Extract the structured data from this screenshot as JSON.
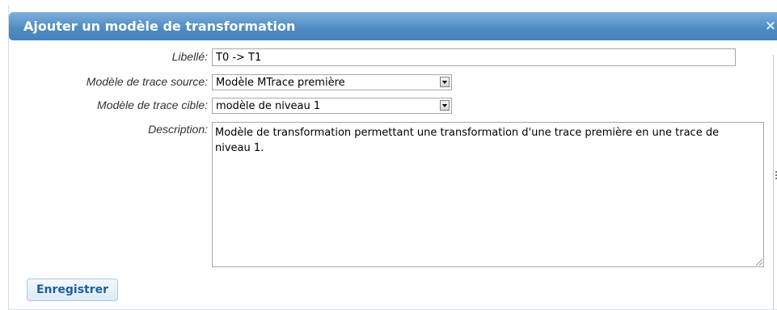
{
  "dialog": {
    "title": "Ajouter un modèle de transformation",
    "close_symbol": "×"
  },
  "form": {
    "libelle": {
      "label": "Libellé:",
      "value": "T0 -> T1"
    },
    "source": {
      "label": "Modèle de trace source:",
      "value": "Modèle MTrace première"
    },
    "cible": {
      "label": "Modèle de trace cible:",
      "value": "modèle de niveau 1"
    },
    "description": {
      "label": "Description:",
      "value": "Modèle de transformation permettant une transformation d'une trace première en une trace de niveau 1."
    }
  },
  "actions": {
    "save_label": "Enregistrer"
  },
  "colors": {
    "titlebar": "#4e8ac2",
    "button_text": "#1f5f9a"
  }
}
